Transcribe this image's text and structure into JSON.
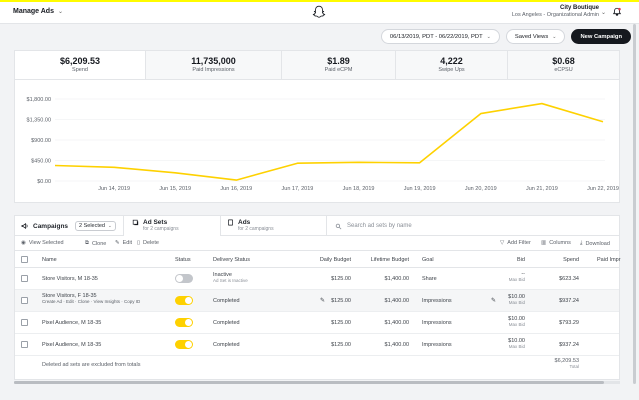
{
  "header": {
    "title": "Manage Ads",
    "account_name": "City Boutique",
    "account_sub": "Los Angeles - Organizational Admin"
  },
  "controls": {
    "date_range": "06/13/2019, PDT - 06/22/2019, PDT",
    "saved_views": "Saved Views",
    "new_campaign": "New Campaign"
  },
  "metrics": [
    {
      "value": "$6,209.53",
      "label": "Spend"
    },
    {
      "value": "11,735,000",
      "label": "Paid Impressions"
    },
    {
      "value": "$1.89",
      "label": "Paid eCPM"
    },
    {
      "value": "4,222",
      "label": "Swipe Ups"
    },
    {
      "value": "$0.68",
      "label": "eCPSU"
    }
  ],
  "chart_data": {
    "type": "line",
    "x": [
      "Jun 14, 2019",
      "Jun 15, 2019",
      "Jun 16, 2019",
      "Jun 17, 2019",
      "Jun 18, 2019",
      "Jun 19, 2019",
      "Jun 20, 2019",
      "Jun 21, 2019",
      "Jun 22, 2019"
    ],
    "y_ticks": [
      "$0.00",
      "$450.00",
      "$900.00",
      "$1,350.00",
      "$1,800.00"
    ],
    "ylim": [
      0,
      1800
    ],
    "series": [
      {
        "values": [
          300,
          180,
          20,
          390,
          410,
          400,
          1480,
          1700,
          1300
        ]
      }
    ],
    "x_start_value": 340,
    "color": "#fed100",
    "grid": true
  },
  "tabs": {
    "campaigns": "Campaigns",
    "selected": "2 Selected",
    "adsets": "Ad Sets",
    "adsets_sub": "for 2 campaigns",
    "ads": "Ads",
    "ads_sub": "for 2 campaigns",
    "search_placeholder": "Search ad sets by name"
  },
  "toolbar": {
    "view_selected": "View Selected",
    "clone": "Clone",
    "edit": "Edit",
    "delete": "Delete",
    "add_filter": "Add Filter",
    "columns": "Columns",
    "download": "Download"
  },
  "columns": {
    "name": "Name",
    "status": "Status",
    "delivery": "Delivery Status",
    "daily": "Daily Budget",
    "lifetime": "Lifetime Budget",
    "goal": "Goal",
    "bid": "Bid",
    "spend": "Spend",
    "paid_imp": "Paid Impr"
  },
  "rows": [
    {
      "name": "Store Visitors, M 18-35",
      "delivery": "Inactive",
      "delivery_sub": "Ad Set is Inactive",
      "daily": "$125.00",
      "lifetime": "$1,400.00",
      "goal": "Share",
      "bid": "--",
      "bid_sub": "Max Bid",
      "spend": "$623.34"
    },
    {
      "name": "Store Visitors, F 18-35",
      "links": "Create Ad · Edit · Clone · View Insights · Copy ID",
      "delivery": "Completed",
      "daily": "$125.00",
      "lifetime": "$1,400.00",
      "goal": "Impressions",
      "bid": "$10.00",
      "bid_sub": "Max Bid",
      "spend": "$937.24"
    },
    {
      "name": "Pixel Audience, M 18-35",
      "delivery": "Completed",
      "daily": "$125.00",
      "lifetime": "$1,400.00",
      "goal": "Impressions",
      "bid": "$10.00",
      "bid_sub": "Max Bid",
      "spend": "$793.29"
    },
    {
      "name": "Pixel Audience, M 18-35",
      "delivery": "Completed",
      "daily": "$125.00",
      "lifetime": "$1,400.00",
      "goal": "Impressions",
      "bid": "$10.00",
      "bid_sub": "Max Bid",
      "spend": "$937.24"
    }
  ],
  "footer": {
    "note": "Deleted ad sets are excluded from totals",
    "total_value": "$6,209.53",
    "total_label": "Total"
  }
}
